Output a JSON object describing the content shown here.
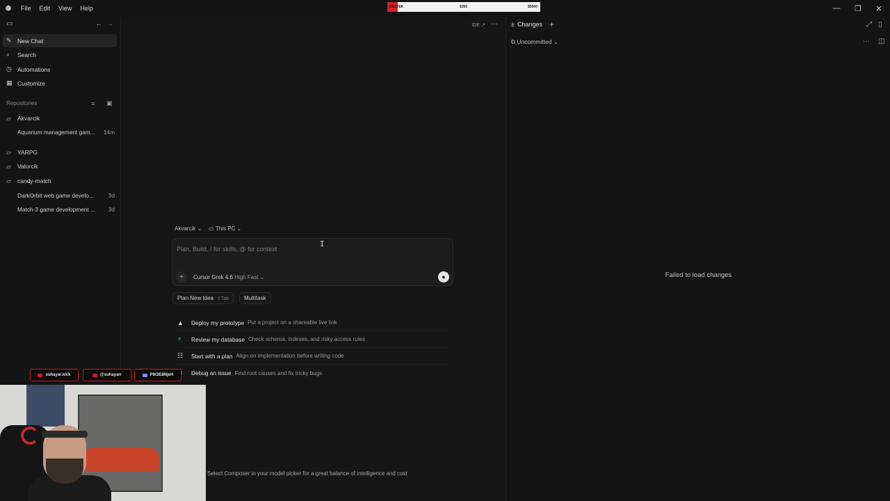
{
  "menubar": {
    "items": [
      "File",
      "Edit",
      "View",
      "Help"
    ]
  },
  "banner": {
    "label": "DESTEK",
    "current": "$350",
    "goal": "$5000",
    "progress": 0.07,
    "fill_color": "#d32121"
  },
  "sidebar": {
    "nav": [
      {
        "label": "New Chat",
        "icon": "edit-icon"
      },
      {
        "label": "Search",
        "icon": "search-icon"
      },
      {
        "label": "Automations",
        "icon": "clock-icon"
      },
      {
        "label": "Customize",
        "icon": "grid-icon"
      }
    ],
    "section_title": "Repositories",
    "repos": [
      {
        "name": "Akvarcik",
        "chats": [
          {
            "title": "Aquarium management gam...",
            "ago": "14m"
          }
        ]
      },
      {
        "name": "YARPG",
        "chats": []
      },
      {
        "name": "Valorcik",
        "chats": []
      },
      {
        "name": "candy-match",
        "chats": [
          {
            "title": "DarkOrbit web game develo...",
            "ago": "3d"
          },
          {
            "title": "Match-3 game development ...",
            "ago": "3d"
          }
        ]
      }
    ]
  },
  "main": {
    "ide_label": "IDE ↗",
    "context": {
      "repo": "Akvarcik",
      "location": "This PC"
    },
    "composer": {
      "placeholder": "Plan, Build, / for skills, @ for context",
      "model": "Cursor Grok 4.6",
      "model_variant": "High Fast"
    },
    "chips": [
      {
        "label": "Plan New Idea",
        "shortcut": "⇧Tab"
      },
      {
        "label": "Multitask",
        "shortcut": ""
      }
    ],
    "suggestions": [
      {
        "title": "Deploy my prototype",
        "desc": "Put a project on a shareable live link",
        "icon": "triangle-icon"
      },
      {
        "title": "Review my database",
        "desc": "Check schema, indexes, and risky access rules",
        "icon": "database-icon"
      },
      {
        "title": "Start with a plan",
        "desc": "Align on implementation before writing code",
        "icon": "list-icon"
      },
      {
        "title": "Debug an issue",
        "desc": "Find root causes and fix tricky bugs",
        "icon": "bug-icon"
      }
    ],
    "tip": "Select Composer in your model picker for a great balance of intelligence and cost"
  },
  "right_panel": {
    "tab": "Changes",
    "filter": "Uncommitted",
    "empty_message": "Failed to load changes"
  },
  "overlay": {
    "socials": [
      "suhayar.kick",
      "@suhayarr",
      "P8t3E8NjeH"
    ],
    "accent": "#c11c1c"
  }
}
